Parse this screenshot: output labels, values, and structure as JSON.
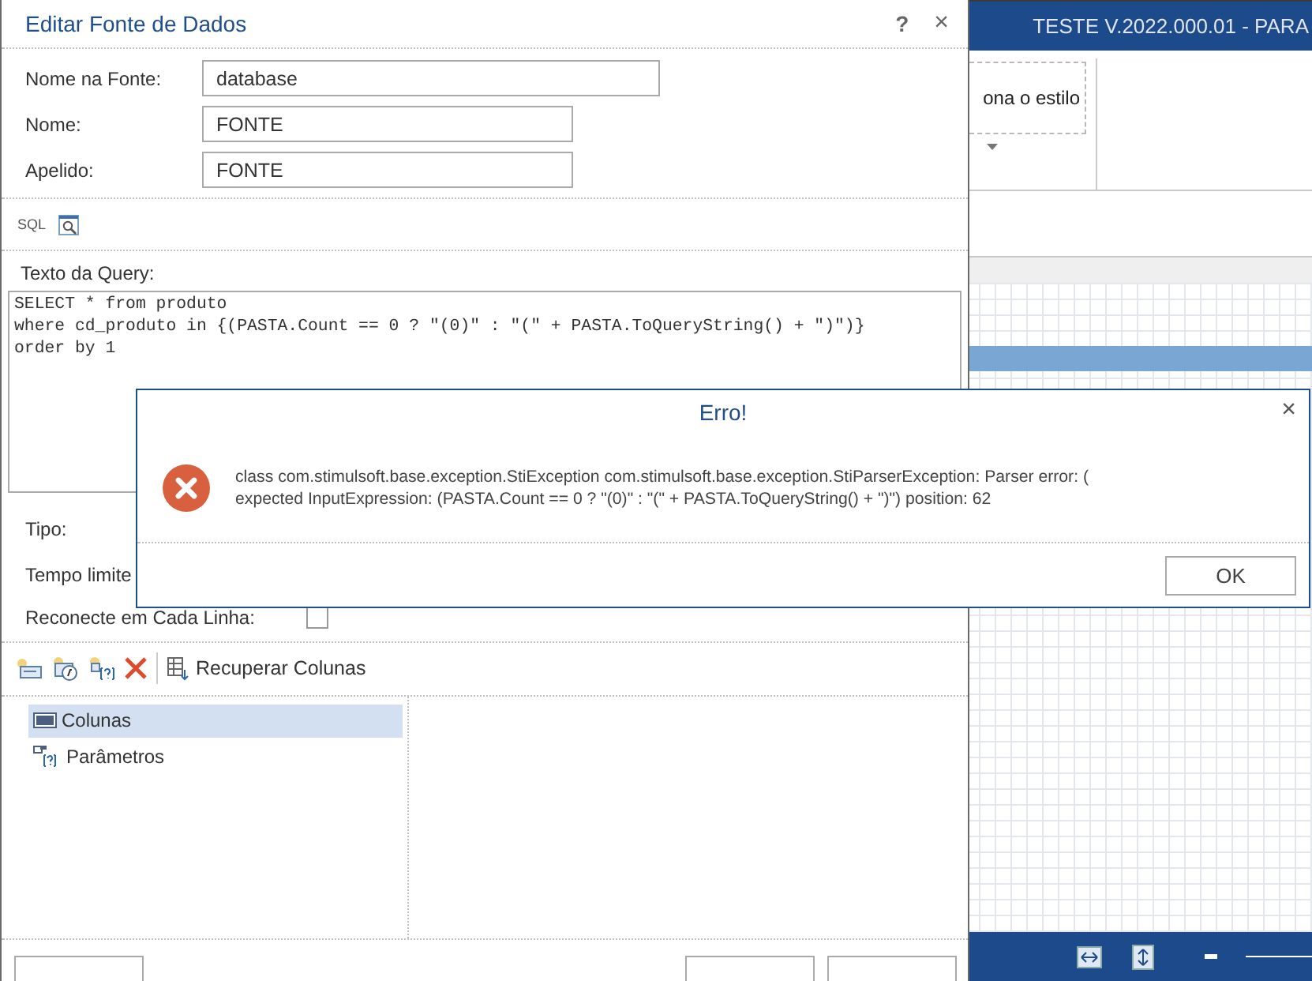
{
  "background_app": {
    "title": "TESTE V.2022.000.01 - PARA",
    "style_box": {
      "label": "ona o estilo"
    }
  },
  "dialog": {
    "title": "Editar Fonte de Dados",
    "help": "?",
    "close": "×",
    "fields": [
      {
        "label": "Nome na Fonte:",
        "value": "database",
        "kind": "wide"
      },
      {
        "label": "Nome:",
        "value": "FONTE",
        "kind": "short"
      },
      {
        "label": "Apelido:",
        "value": "FONTE",
        "kind": "short"
      }
    ],
    "sql_label": "SQL",
    "query_label": "Texto da Query:",
    "query_lines": [
      "SELECT * from produto",
      "where cd_produto in {(PASTA.Count == 0 ? \"(0)\" : \"(\" + PASTA.ToQueryString() + \")\")}",
      "order by 1"
    ],
    "type_label": "Tipo:",
    "timeout_label": "Tempo limite",
    "reconnect": {
      "label": "Reconecte em Cada Linha:",
      "checked": false
    },
    "toolbar": {
      "retrieve_label": "Recuperar Colunas"
    },
    "tree": [
      {
        "label": "Colunas",
        "kind": "columns",
        "selected": true
      },
      {
        "label": "Parâmetros",
        "kind": "parameters",
        "selected": false
      }
    ]
  },
  "error_dialog": {
    "title": "Erro!",
    "close": "×",
    "message_lines": [
      "class com.stimulsoft.base.exception.StiException com.stimulsoft.base.exception.StiParserException: Parser error: (",
      "expected InputExpression: (PASTA.Count == 0 ? \"(0)\" : \"(\" + PASTA.ToQueryString() + \")\") position: 62"
    ],
    "ok": "OK"
  }
}
